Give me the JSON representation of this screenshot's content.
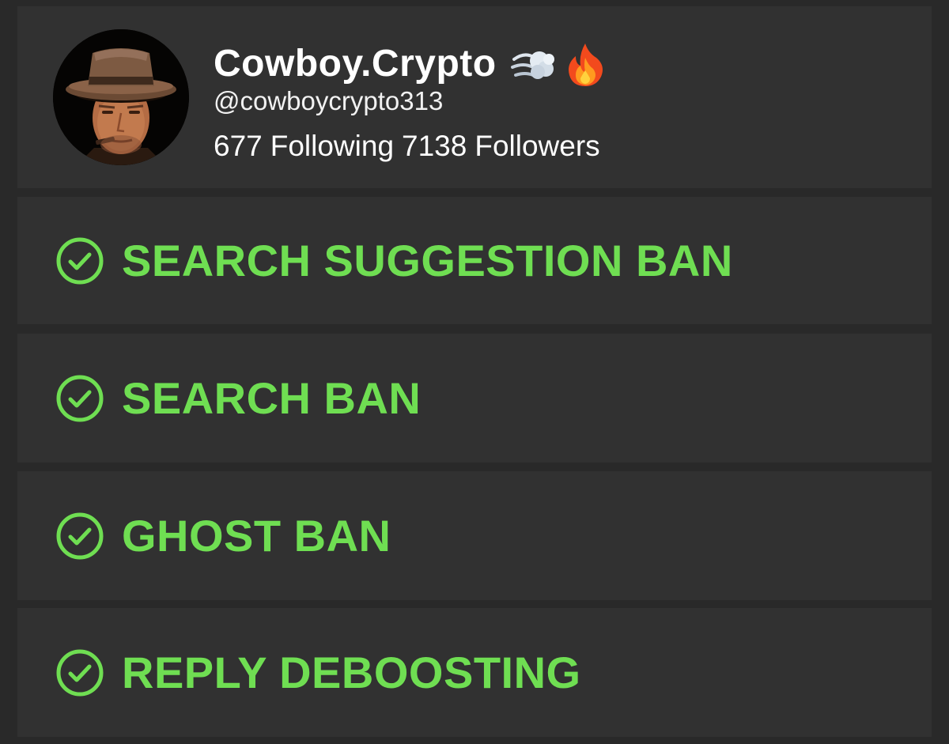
{
  "profile": {
    "display_name": "Cowboy.Crypto",
    "emojis": [
      "dashing-away-emoji",
      "fire-emoji"
    ],
    "handle": "@cowboycrypto313",
    "following_count": "677",
    "following_label": "Following",
    "followers_count": "7138",
    "followers_label": "Followers",
    "avatar_icon": "cowboy-portrait"
  },
  "checks": [
    {
      "label": "SEARCH SUGGESTION BAN",
      "icon": "check-circle-icon",
      "status": "passed"
    },
    {
      "label": "SEARCH BAN",
      "icon": "check-circle-icon",
      "status": "passed"
    },
    {
      "label": "GHOST BAN",
      "icon": "check-circle-icon",
      "status": "passed"
    },
    {
      "label": "REPLY DEBOOSTING",
      "icon": "check-circle-icon",
      "status": "passed"
    }
  ],
  "colors": {
    "background": "#292929",
    "card": "#313131",
    "pass_green": "#6fde52",
    "text": "#ffffff"
  }
}
